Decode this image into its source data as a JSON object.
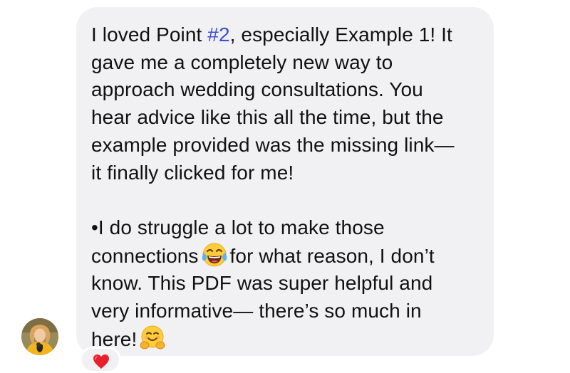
{
  "message": {
    "paragraph1": {
      "line1_before": "I loved Point ",
      "hashtag": "#2",
      "line1_after": ", especially Example 1! It",
      "line2": "gave me a completely new way to",
      "line3": "approach wedding consultations. You",
      "line4": "hear advice like this all the time, but the",
      "line5": "example provided was the missing link—",
      "line6": "it finally clicked for me!"
    },
    "paragraph2": {
      "line1": "•I do struggle a lot to make those",
      "line2_before": "connections",
      "line2_emoji": "face-with-tears-of-joy-icon",
      "line2_after": "for what reason, I don’t",
      "line3": "know. This PDF was super helpful and",
      "line4": "very informative— there’s so much in",
      "line5_before": "here!",
      "line5_emoji": "hugging-face-icon"
    }
  },
  "reaction": {
    "icon": "red-heart-icon",
    "color": "#e8202c"
  },
  "colors": {
    "bubble": "#f1f1f3",
    "text": "#111111",
    "hashtag": "#3b4fd8"
  }
}
